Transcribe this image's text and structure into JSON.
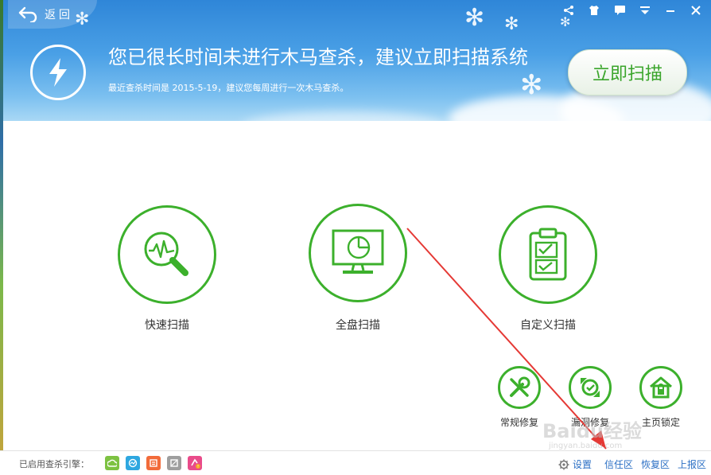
{
  "header": {
    "back_label": "返回",
    "headline": "您已很长时间未进行木马查杀，建议立即扫描系统",
    "subline": "最近查杀时间是 2015-5-19，建议您每周进行一次木马查杀。",
    "scan_now_label": "立即扫描"
  },
  "window_controls": [
    {
      "name": "share-icon"
    },
    {
      "name": "skin-icon"
    },
    {
      "name": "message-icon"
    },
    {
      "name": "menu-icon"
    },
    {
      "name": "minimize-icon"
    },
    {
      "name": "close-icon"
    }
  ],
  "scan_modes": [
    {
      "name": "quick-scan",
      "label": "快速扫描",
      "icon": "magnifier-pulse-icon"
    },
    {
      "name": "full-scan",
      "label": "全盘扫描",
      "icon": "monitor-icon"
    },
    {
      "name": "custom-scan",
      "label": "自定义扫描",
      "icon": "clipboard-check-icon"
    }
  ],
  "tools": [
    {
      "name": "regular-repair",
      "label": "常规修复",
      "icon": "wrench-screwdriver-icon"
    },
    {
      "name": "vulnerability-repair",
      "label": "漏洞修复",
      "icon": "shield-refresh-icon"
    },
    {
      "name": "homepage-lock",
      "label": "主页锁定",
      "icon": "house-lock-icon"
    }
  ],
  "footer": {
    "engines_label": "已启用查杀引擎：",
    "engines": [
      {
        "name": "cloud-engine-icon",
        "color": "#7dc242"
      },
      {
        "name": "qvm-engine-icon",
        "color": "#2ea7e0"
      },
      {
        "name": "system-repair-engine-icon",
        "color": "#f26b3a"
      },
      {
        "name": "qex-engine-icon",
        "color": "#9e9e9e"
      },
      {
        "name": "avira-engine-icon",
        "color": "#e94b8a"
      }
    ],
    "links": [
      {
        "name": "settings-link",
        "label": "设置"
      },
      {
        "name": "trust-zone-link",
        "label": "信任区"
      },
      {
        "name": "restore-zone-link",
        "label": "恢复区"
      },
      {
        "name": "report-zone-link",
        "label": "上报区"
      }
    ]
  },
  "watermark": {
    "main": "Baidu经验",
    "sub": "jingyan.baidu.com"
  },
  "colors": {
    "accent_green": "#3cb02c",
    "link_blue": "#2b6fc4",
    "header_blue": "#2f86d8",
    "arrow_red": "#e53935"
  }
}
